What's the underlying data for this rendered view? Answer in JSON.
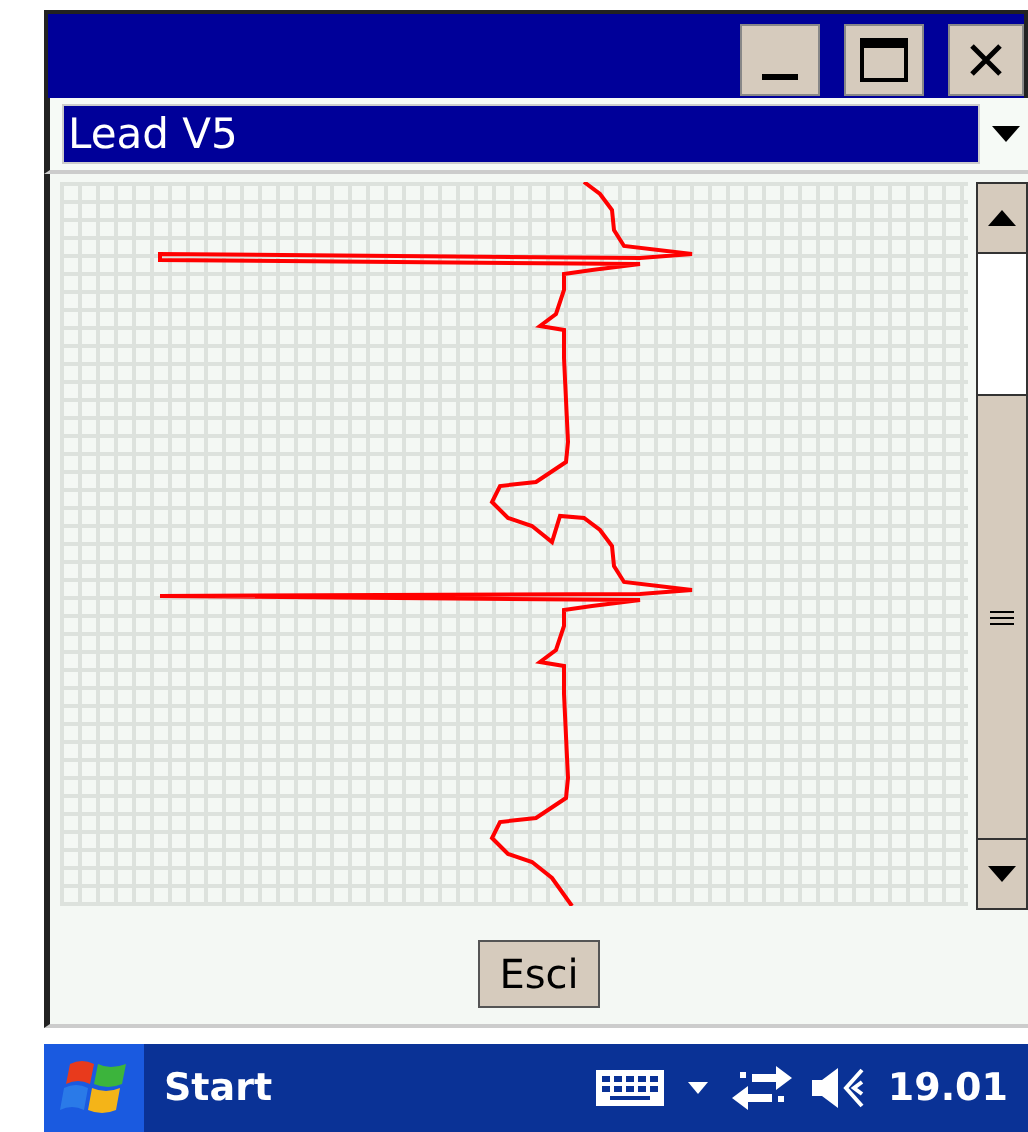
{
  "lead_select": {
    "value": "Lead V5",
    "focused": true
  },
  "buttons": [
    {
      "label": "Esci"
    }
  ],
  "taskbar": {
    "start": "Start",
    "clock": "19.01"
  }
}
